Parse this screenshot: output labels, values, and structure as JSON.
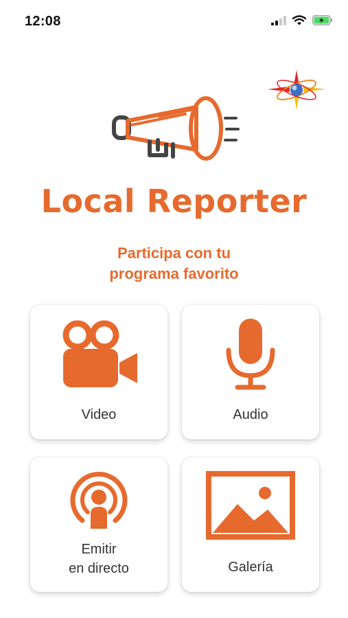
{
  "status_bar": {
    "time": "12:08",
    "icons": [
      "cellular-signal-icon",
      "wifi-icon",
      "battery-charging-icon"
    ]
  },
  "header": {
    "brand_name": "Local Reporter",
    "tagline_line1": "Participa con tu",
    "tagline_line2": "programa favorito",
    "icons": [
      "megaphone-icon",
      "station-logo-icon"
    ]
  },
  "tiles": [
    {
      "label": "Video",
      "icon": "video-camera-icon"
    },
    {
      "label": "Audio",
      "icon": "microphone-icon"
    },
    {
      "label_line1": "Emitir",
      "label_line2": "en directo",
      "icon": "live-broadcast-icon"
    },
    {
      "label": "Galería",
      "icon": "gallery-image-icon"
    }
  ],
  "colors": {
    "accent": "#e66a2e",
    "text": "#333333",
    "background": "#ffffff",
    "battery": "#4cd964"
  }
}
